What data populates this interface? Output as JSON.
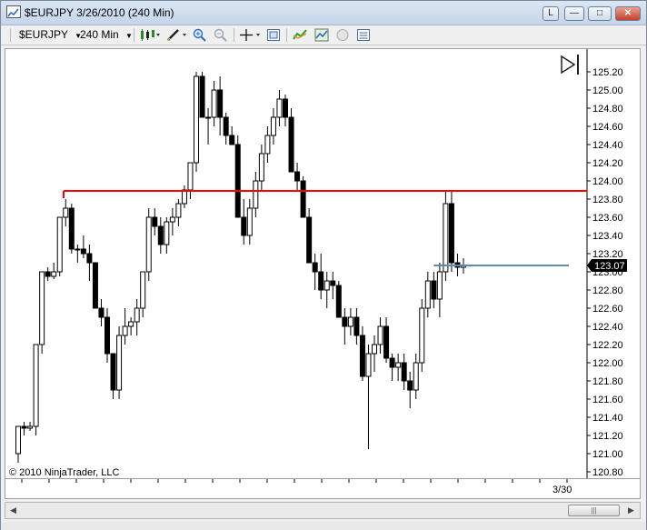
{
  "window": {
    "title": "$EURJPY  3/26/2010 (240 Min)",
    "restore_glyph": "L",
    "minimize_glyph": "—",
    "maximize_glyph": "□",
    "close_glyph": "✕"
  },
  "toolbar": {
    "instrument": "$EURJPY",
    "period": "240 Min",
    "icons": [
      "candlestick-style-icon",
      "drawing-pencil-icon",
      "zoom-in-icon",
      "zoom-out-icon",
      "crosshair-icon",
      "chart-properties-icon",
      "indicators-icon",
      "strategies-icon",
      "clock-icon",
      "data-box-icon"
    ]
  },
  "chart": {
    "copyright": "© 2010 NinjaTrader, LLC",
    "last_price": "123.07",
    "date_label": "3/30",
    "accent_red": "#ff0000",
    "accent_blue": "#5b8ab6",
    "price_badge_color": "#000000"
  },
  "chart_data": {
    "type": "candlestick",
    "ylim": [
      120.8,
      125.3
    ],
    "y_ticks": [
      "125.20",
      "125.00",
      "124.80",
      "124.60",
      "124.40",
      "124.20",
      "124.00",
      "123.80",
      "123.60",
      "123.40",
      "123.20",
      "123.00",
      "122.80",
      "122.60",
      "122.40",
      "122.20",
      "122.00",
      "121.80",
      "121.60",
      "121.40",
      "121.20",
      "121.00",
      "120.80"
    ],
    "x_ticks": [
      "3/30"
    ],
    "resistance_line": 123.89,
    "current_price_line": 123.07,
    "candles": [
      [
        121.0,
        121.3,
        120.9,
        121.3
      ],
      [
        121.3,
        121.35,
        121.2,
        121.28
      ],
      [
        121.28,
        121.35,
        121.25,
        121.3
      ],
      [
        121.3,
        122.2,
        121.2,
        122.2
      ],
      [
        122.2,
        123.0,
        122.1,
        123.0
      ],
      [
        123.0,
        123.05,
        122.9,
        122.95
      ],
      [
        122.95,
        123.1,
        122.92,
        123.0
      ],
      [
        123.0,
        123.6,
        122.95,
        123.6
      ],
      [
        123.6,
        123.8,
        123.5,
        123.7
      ],
      [
        123.7,
        123.75,
        123.2,
        123.25
      ],
      [
        123.25,
        123.3,
        123.1,
        123.25
      ],
      [
        123.25,
        123.4,
        123.15,
        123.2
      ],
      [
        123.2,
        123.3,
        122.9,
        123.1
      ],
      [
        123.1,
        123.1,
        122.6,
        122.6
      ],
      [
        122.6,
        122.7,
        122.4,
        122.5
      ],
      [
        122.5,
        122.6,
        122.0,
        122.1
      ],
      [
        122.1,
        122.1,
        121.6,
        121.7
      ],
      [
        121.7,
        122.4,
        121.6,
        122.3
      ],
      [
        122.3,
        122.6,
        122.2,
        122.4
      ],
      [
        122.4,
        122.5,
        122.3,
        122.45
      ],
      [
        122.45,
        122.7,
        122.3,
        122.6
      ],
      [
        122.6,
        123.0,
        122.5,
        123.0
      ],
      [
        123.0,
        123.7,
        122.9,
        123.6
      ],
      [
        123.6,
        123.7,
        123.4,
        123.5
      ],
      [
        123.5,
        123.6,
        123.2,
        123.3
      ],
      [
        123.3,
        123.6,
        123.2,
        123.55
      ],
      [
        123.55,
        123.7,
        123.4,
        123.6
      ],
      [
        123.6,
        123.8,
        123.5,
        123.75
      ],
      [
        123.75,
        123.95,
        123.7,
        123.9
      ],
      [
        123.9,
        124.2,
        123.8,
        124.2
      ],
      [
        124.2,
        125.2,
        124.1,
        125.15
      ],
      [
        125.15,
        125.2,
        124.7,
        124.7
      ],
      [
        124.7,
        124.8,
        124.4,
        124.7
      ],
      [
        124.7,
        125.1,
        124.6,
        125.0
      ],
      [
        125.0,
        125.15,
        124.5,
        124.7
      ],
      [
        124.7,
        124.75,
        124.4,
        124.5
      ],
      [
        124.5,
        124.6,
        124.4,
        124.4
      ],
      [
        124.4,
        124.5,
        123.6,
        123.6
      ],
      [
        123.6,
        123.8,
        123.3,
        123.4
      ],
      [
        123.4,
        123.8,
        123.3,
        123.7
      ],
      [
        123.7,
        124.1,
        123.6,
        124.0
      ],
      [
        124.0,
        124.4,
        123.9,
        124.3
      ],
      [
        124.3,
        124.6,
        124.2,
        124.5
      ],
      [
        124.5,
        124.8,
        124.4,
        124.7
      ],
      [
        124.7,
        125.0,
        124.6,
        124.9
      ],
      [
        124.9,
        124.95,
        124.6,
        124.7
      ],
      [
        124.7,
        124.8,
        124.1,
        124.1
      ],
      [
        124.1,
        124.2,
        123.9,
        124.0
      ],
      [
        124.0,
        124.05,
        123.6,
        123.6
      ],
      [
        123.6,
        123.7,
        123.1,
        123.1
      ],
      [
        123.1,
        123.2,
        122.8,
        123.0
      ],
      [
        123.0,
        123.2,
        122.7,
        122.8
      ],
      [
        122.8,
        123.0,
        122.6,
        122.9
      ],
      [
        122.9,
        123.0,
        122.7,
        122.85
      ],
      [
        122.85,
        122.9,
        122.5,
        122.5
      ],
      [
        122.5,
        122.6,
        122.2,
        122.4
      ],
      [
        122.4,
        122.6,
        122.3,
        122.5
      ],
      [
        122.5,
        122.6,
        122.2,
        122.3
      ],
      [
        122.3,
        122.4,
        121.8,
        121.85
      ],
      [
        121.85,
        122.2,
        121.05,
        122.1
      ],
      [
        122.1,
        122.3,
        121.9,
        122.2
      ],
      [
        122.2,
        122.5,
        122.1,
        122.4
      ],
      [
        122.4,
        122.5,
        122.0,
        122.05
      ],
      [
        122.05,
        122.1,
        121.8,
        121.95
      ],
      [
        121.95,
        122.1,
        121.8,
        122.0
      ],
      [
        122.0,
        122.1,
        121.7,
        121.8
      ],
      [
        121.8,
        121.9,
        121.5,
        121.7
      ],
      [
        121.7,
        122.1,
        121.6,
        122.0
      ],
      [
        122.0,
        122.7,
        121.9,
        122.6
      ],
      [
        122.6,
        123.0,
        122.5,
        122.9
      ],
      [
        122.9,
        123.0,
        122.6,
        122.7
      ],
      [
        122.7,
        123.1,
        122.5,
        123.0
      ],
      [
        123.0,
        123.9,
        122.9,
        123.75
      ],
      [
        123.75,
        123.9,
        123.0,
        123.1
      ],
      [
        123.1,
        123.2,
        122.95,
        123.05
      ],
      [
        123.05,
        123.15,
        122.98,
        123.07
      ]
    ]
  }
}
